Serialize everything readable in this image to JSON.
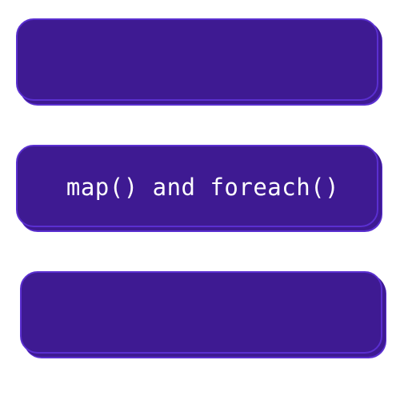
{
  "cards": [
    {
      "label": ""
    },
    {
      "label": "map() and foreach()"
    },
    {
      "label": ""
    }
  ],
  "colors": {
    "background": "#ffffff",
    "card_fill": "#3e1a92",
    "card_border": "#5a2fd0",
    "text": "#ffffff"
  }
}
